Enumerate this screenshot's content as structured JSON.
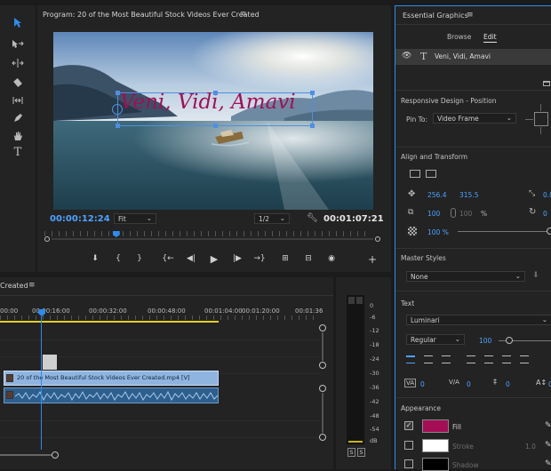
{
  "program": {
    "title": "Program: 20 of the Most Beautiful Stock Videos Ever Created",
    "menu_icon": "≡",
    "overlay_text": "Veni, Vidi, Amavi",
    "current_time": "00:00:12:24",
    "fit": "Fit",
    "resolution": "1/2",
    "duration": "00:01:07:21",
    "playhead_fraction": 0.19,
    "controls": [
      "marker-icon",
      "mark-in-icon",
      "mark-out-icon",
      "go-to-in-icon",
      "step-back-icon",
      "play-icon",
      "step-forward-icon",
      "go-to-out-icon",
      "lift-icon",
      "extract-icon",
      "export-frame-icon",
      "add-icon"
    ]
  },
  "timeline": {
    "title": "Created",
    "menu_icon": "≡",
    "ruler": [
      "00:00",
      "00:00:16:00",
      "00:00:32:00",
      "00:00:48:00",
      "00:01:04:00",
      "00:01:20:00",
      "00:01:36"
    ],
    "clip_label": "20 of the Most Beautiful Stock Videos Ever Created.mp4 [V]"
  },
  "meter": {
    "scale": [
      "0",
      "-6",
      "-12",
      "-18",
      "-24",
      "-30",
      "-36",
      "-42",
      "-48",
      "-54",
      "dB"
    ],
    "solo_labels": [
      "S",
      "S"
    ]
  },
  "essential_graphics": {
    "title": "Essential Graphics",
    "menu_icon": "≡",
    "tabs": [
      "Browse",
      "Edit"
    ],
    "active_tab": "Edit",
    "layer_name": "Veni, Vidi, Amavi",
    "responsive_title": "Responsive Design - Position",
    "pin_to_label": "Pin To:",
    "pin_to_value": "Video Frame",
    "align_title": "Align and Transform",
    "position_x": "256.4",
    "position_y": "315.5",
    "rotation_partial": "0.0",
    "scale": "100",
    "scale_linked": "100",
    "scale_unit": "%",
    "rotation_value": "0",
    "opacity": "100 %",
    "master_styles_title": "Master Styles",
    "master_style_value": "None",
    "text_title": "Text",
    "font": "Luminari",
    "font_style": "Regular",
    "font_size": "100",
    "tracking_values": [
      "0",
      "0",
      "0",
      "0"
    ],
    "appearance_title": "Appearance",
    "fill_label": "Fill",
    "stroke_label": "Stroke",
    "stroke_width": "1.0",
    "shadow_label": "Shadow",
    "colors": {
      "fill": "#a50d55",
      "stroke": "#ffffff",
      "shadow": "#000000",
      "accent": "#2d8ceb"
    }
  }
}
